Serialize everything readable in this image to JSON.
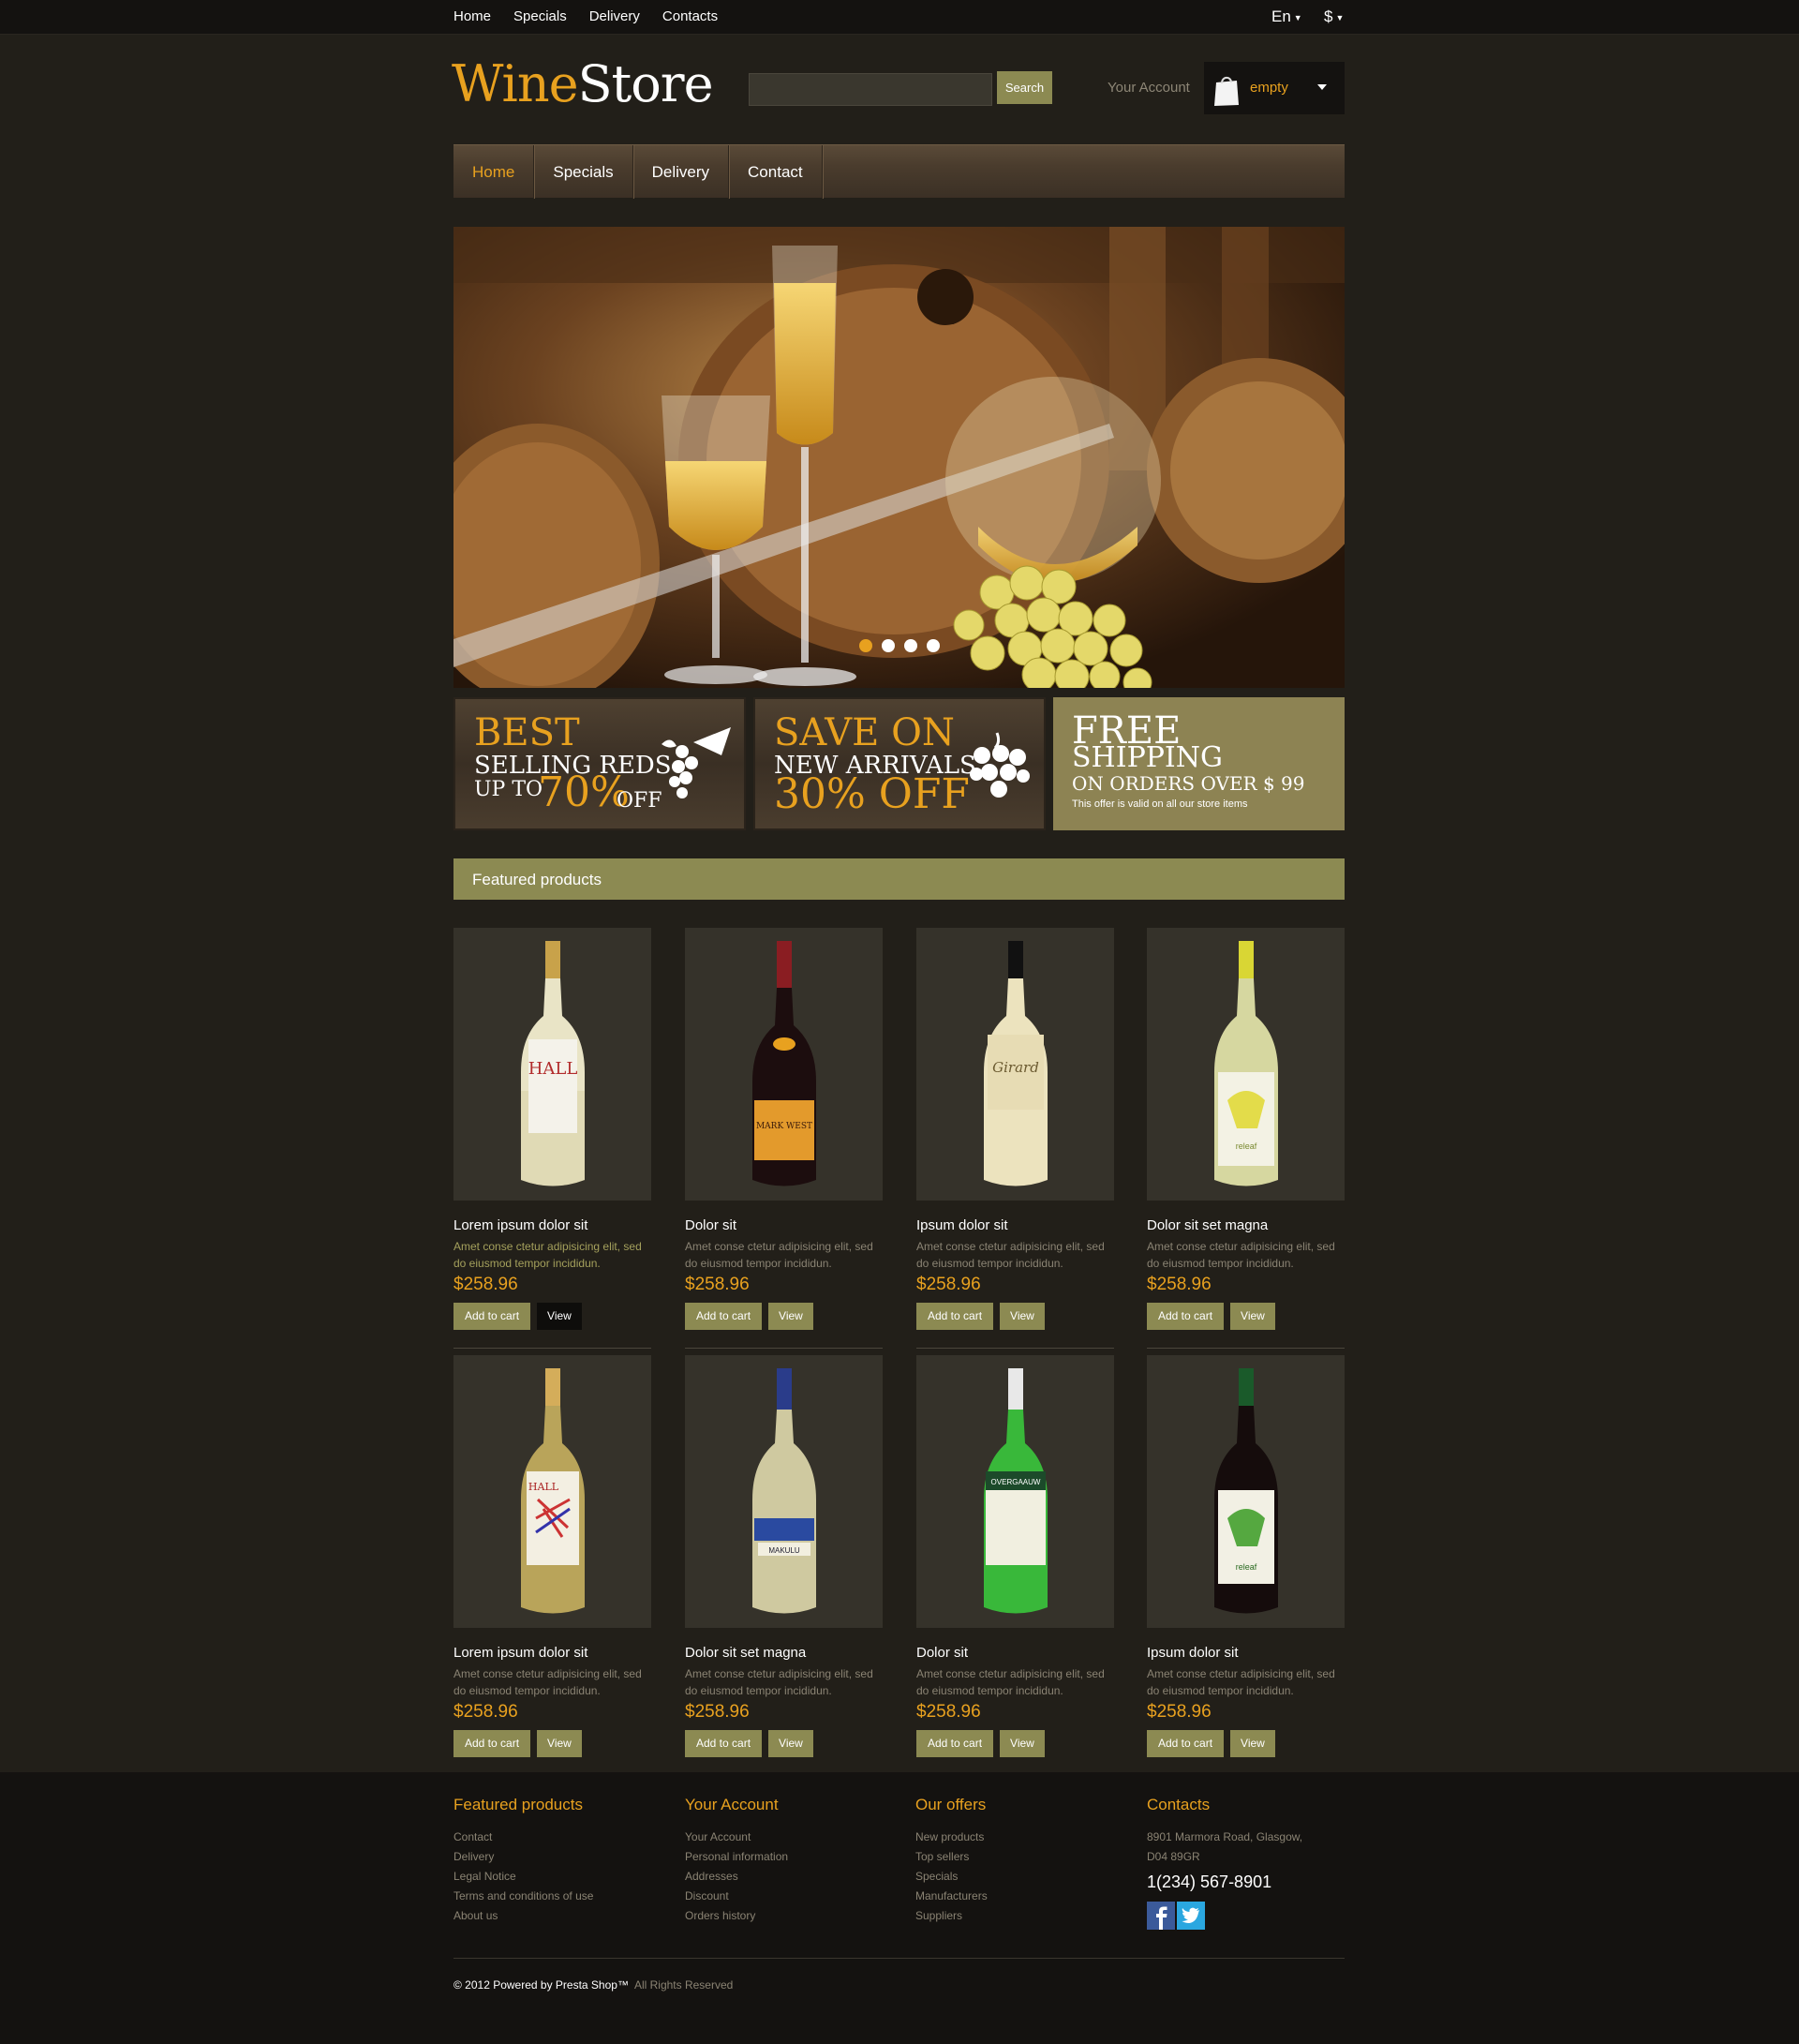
{
  "topbar": {
    "links": [
      "Home",
      "Specials",
      "Delivery",
      "Contacts"
    ],
    "language": "En",
    "currency": "$"
  },
  "header": {
    "logo_part1": "Wine",
    "logo_part2": "Store",
    "search_placeholder": "",
    "search_button": "Search",
    "account_link": "Your Account",
    "cart_status": "empty"
  },
  "main_nav": {
    "items": [
      "Home",
      "Specials",
      "Delivery",
      "Contact"
    ],
    "active": "Home"
  },
  "slider": {
    "slide_count": 4,
    "active_index": 0
  },
  "promos": [
    {
      "line1": "BEST",
      "line2": "SELLING REDS",
      "line3a": "UP TO",
      "line3b": "70%",
      "line3c": "OFF"
    },
    {
      "line1": "SAVE ON",
      "line2": "NEW ARRIVALS",
      "line3": "30% OFF"
    },
    {
      "line1": "FREE",
      "line2": "SHIPPING",
      "line3": "ON ORDERS OVER $ 99",
      "note": "This offer is valid on all our  store items"
    }
  ],
  "featured": {
    "heading": "Featured products",
    "add_to_cart_label": "Add to cart",
    "view_label": "View",
    "products": [
      {
        "name": "Lorem ipsum dolor sit",
        "desc": "Amet conse ctetur adipisicing elit, sed do eiusmod tempor incididun.",
        "price": "$258.96"
      },
      {
        "name": "Dolor sit",
        "desc": "Amet conse ctetur adipisicing elit, sed do eiusmod tempor incididun.",
        "price": "$258.96"
      },
      {
        "name": "Ipsum dolor sit",
        "desc": "Amet conse ctetur adipisicing elit, sed do eiusmod tempor incididun.",
        "price": "$258.96"
      },
      {
        "name": "Dolor sit set magna",
        "desc": "Amet conse ctetur adipisicing elit, sed do eiusmod tempor incididun.",
        "price": "$258.96"
      },
      {
        "name": "Lorem ipsum dolor sit",
        "desc": "Amet conse ctetur adipisicing elit, sed do eiusmod tempor incididun.",
        "price": "$258.96"
      },
      {
        "name": "Dolor sit set magna",
        "desc": "Amet conse ctetur adipisicing elit, sed do eiusmod tempor incididun.",
        "price": "$258.96"
      },
      {
        "name": "Dolor sit",
        "desc": "Amet conse ctetur adipisicing elit, sed do eiusmod tempor incididun.",
        "price": "$258.96"
      },
      {
        "name": "Ipsum dolor sit",
        "desc": "Amet conse ctetur adipisicing elit, sed do eiusmod tempor incididun.",
        "price": "$258.96"
      }
    ]
  },
  "footer": {
    "columns": [
      {
        "title": "Featured products",
        "links": [
          "Contact",
          "Delivery",
          "Legal Notice",
          "Terms and conditions of use",
          "About us"
        ]
      },
      {
        "title": "Your Account",
        "links": [
          "Your Account",
          "Personal information",
          "Addresses",
          "Discount",
          "Orders history"
        ]
      },
      {
        "title": "Our offers",
        "links": [
          "New products",
          "Top sellers",
          "Specials",
          "Manufacturers",
          "Suppliers"
        ]
      }
    ],
    "contacts": {
      "title": "Contacts",
      "address1": "8901 Marmora Road, Glasgow,",
      "address2": "D04 89GR",
      "phone": "1(234) 567-8901"
    },
    "copyright": "© 2012 Powered by Presta Shop™",
    "rights": "All Rights Reserved"
  },
  "colors": {
    "accent": "#e8a11f",
    "olive": "#8c8a52",
    "background": "#221f19"
  }
}
